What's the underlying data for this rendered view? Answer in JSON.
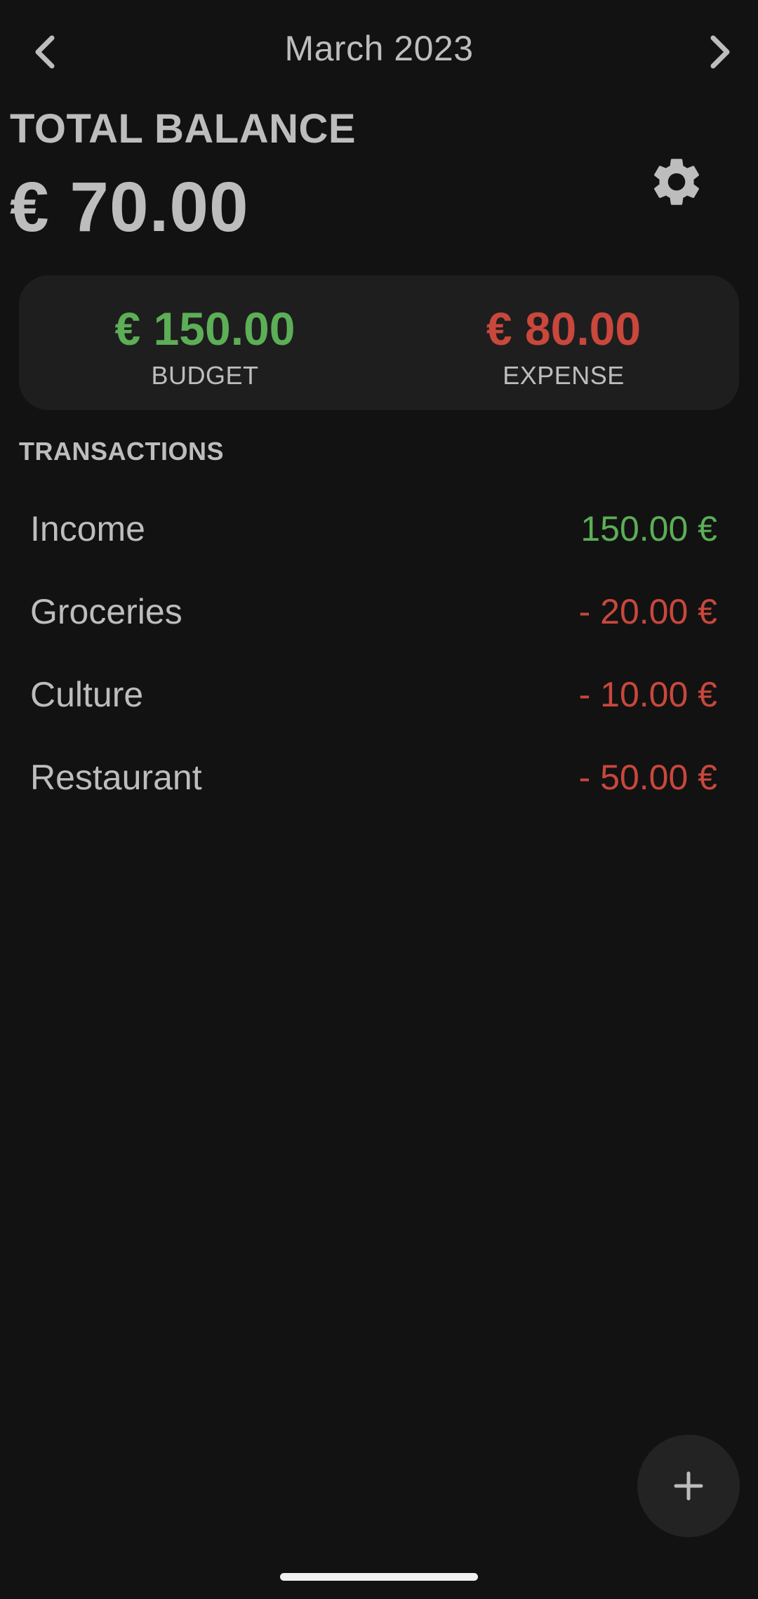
{
  "header": {
    "month_label": "March 2023",
    "prev_icon": "chevron-left-icon",
    "next_icon": "chevron-right-icon"
  },
  "balance": {
    "label": "TOTAL BALANCE",
    "amount": "€ 70.00"
  },
  "settings": {
    "icon": "gear-icon"
  },
  "summary": {
    "budget": {
      "value": "€ 150.00",
      "caption": "BUDGET",
      "color": "#5cae57"
    },
    "expense": {
      "value": "€ 80.00",
      "caption": "EXPENSE",
      "color": "#c9473c"
    }
  },
  "transactions": {
    "title": "TRANSACTIONS",
    "items": [
      {
        "name": "Income",
        "amount": "150.00 €",
        "type": "income"
      },
      {
        "name": "Groceries",
        "amount": "- 20.00 €",
        "type": "expense"
      },
      {
        "name": "Culture",
        "amount": "- 10.00 €",
        "type": "expense"
      },
      {
        "name": "Restaurant",
        "amount": "- 50.00 €",
        "type": "expense"
      }
    ]
  },
  "fab": {
    "icon": "plus-icon"
  },
  "colors": {
    "background": "#121212",
    "card": "#1e1e1e",
    "text": "#bdbdbd",
    "income": "#5cae57",
    "expense": "#c9473c"
  }
}
